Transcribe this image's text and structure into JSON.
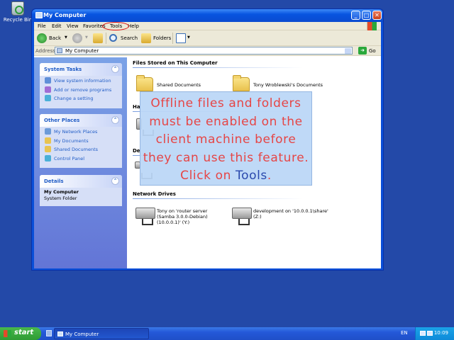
{
  "desktop": {
    "recycle_bin_label": "Recycle Bin"
  },
  "window": {
    "title": "My Computer",
    "controls": {
      "minimize": "_",
      "maximize": "□",
      "close": "✕"
    }
  },
  "menubar": {
    "items": [
      "File",
      "Edit",
      "View",
      "Favorites",
      "Tools",
      "Help"
    ]
  },
  "toolbar": {
    "back": "Back",
    "search": "Search",
    "folders": "Folders"
  },
  "address": {
    "label": "Address",
    "value": "My Computer",
    "go": "Go"
  },
  "sidebar": {
    "system_tasks": {
      "title": "System Tasks",
      "items": [
        "View system information",
        "Add or remove programs",
        "Change a setting"
      ]
    },
    "other_places": {
      "title": "Other Places",
      "items": [
        "My Network Places",
        "My Documents",
        "Shared Documents",
        "Control Panel"
      ]
    },
    "details": {
      "title": "Details",
      "name": "My Computer",
      "type": "System Folder"
    }
  },
  "main": {
    "files_group": {
      "title": "Files Stored on This Computer",
      "items": [
        "Shared Documents",
        "Tony Wroblewski's Documents"
      ]
    },
    "hidden_group_1": "Ha",
    "hidden_group_2": "De",
    "network_group": {
      "title": "Network Drives",
      "items": [
        "Tony on 'router server (Samba 3.0.0-Debian) (10.0.0.1)' (Y:)",
        "development on '10.0.0.1\\share' (Z:)"
      ]
    }
  },
  "tooltip": {
    "text": "Offline files and folders must be enabled on the client machine before they can use this feature. Click on ",
    "highlight": "Tools",
    "end": "."
  },
  "taskbar": {
    "start": "start",
    "task": "My Computer",
    "lang": "EN",
    "clock": "10:09"
  }
}
